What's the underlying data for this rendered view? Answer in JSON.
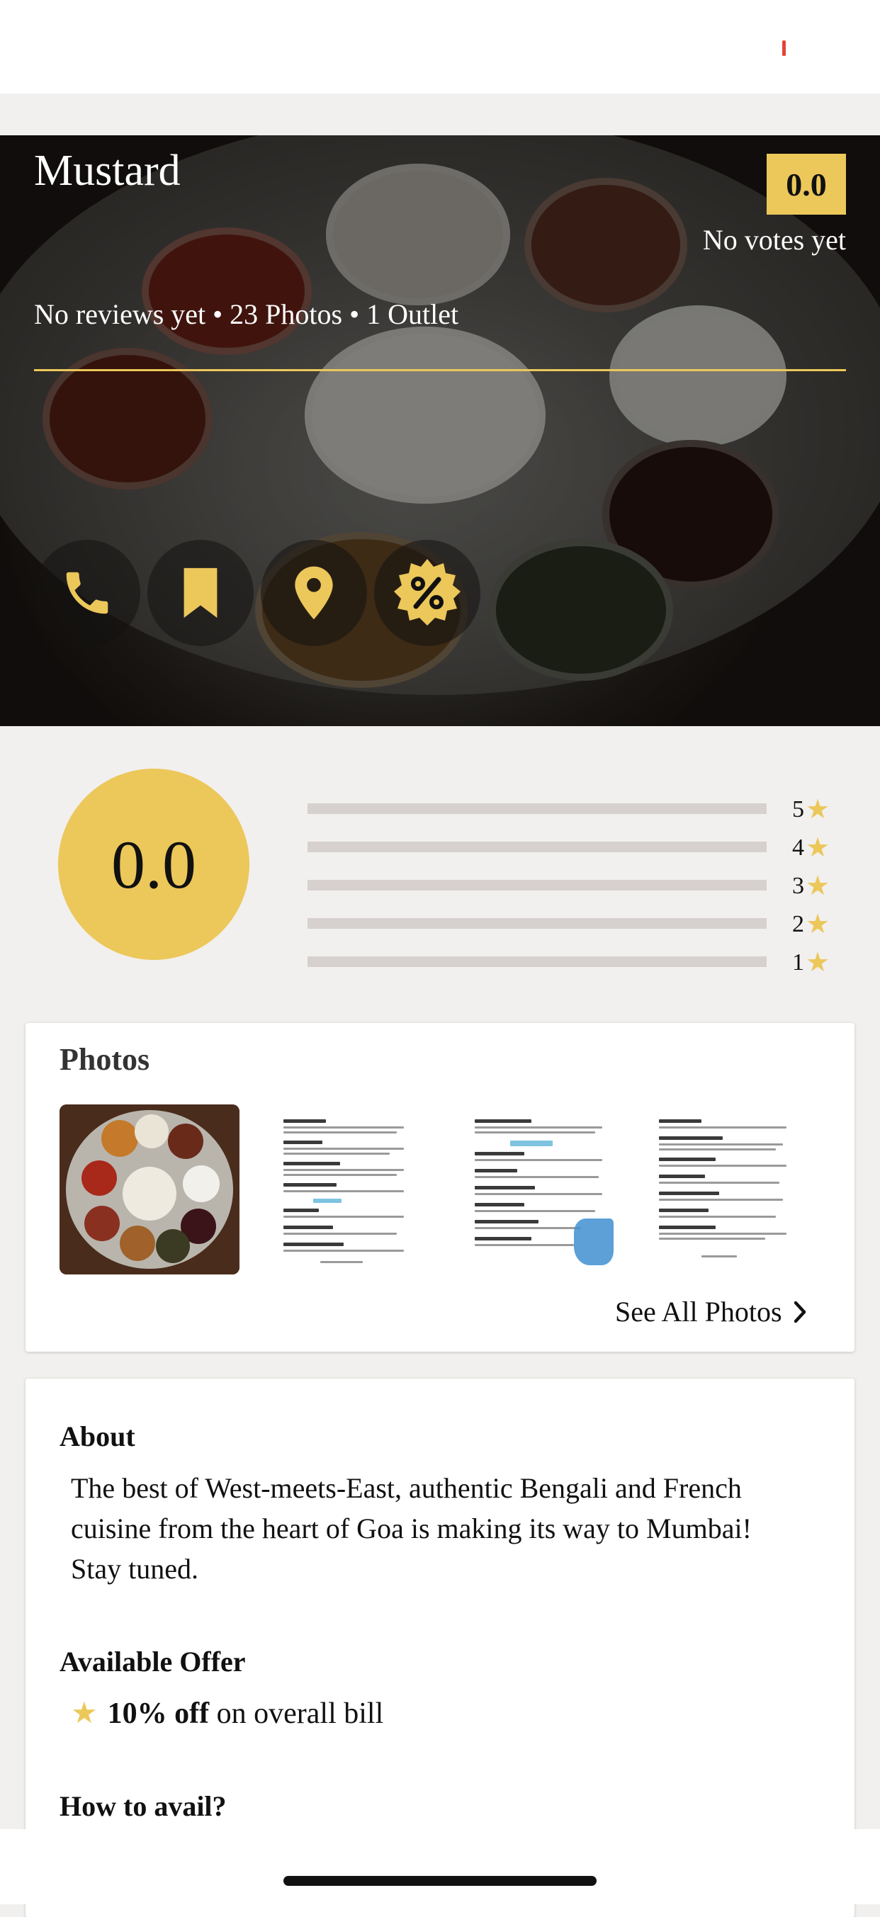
{
  "restaurant": {
    "name": "Mustard",
    "rating": "0.0",
    "votes_text": "No votes yet",
    "summary": "No reviews yet • 23 Photos • 1 Outlet"
  },
  "actions": [
    {
      "icon": "phone-icon"
    },
    {
      "icon": "bookmark-icon"
    },
    {
      "icon": "location-pin-icon"
    },
    {
      "icon": "discount-badge-icon"
    }
  ],
  "ratings": {
    "overall": "0.0",
    "distribution": [
      {
        "label": "5",
        "fraction": 0
      },
      {
        "label": "4",
        "fraction": 0
      },
      {
        "label": "3",
        "fraction": 0
      },
      {
        "label": "2",
        "fraction": 0
      },
      {
        "label": "1",
        "fraction": 0
      }
    ]
  },
  "photos": {
    "title": "Photos",
    "see_all": "See All Photos"
  },
  "about": {
    "title": "About",
    "text": "The best of West-meets-East, authentic Bengali and French cuisine from the heart of Goa is making its way to Mumbai! Stay tuned."
  },
  "offer": {
    "title": "Available Offer",
    "bold": "10% off",
    "rest": "on overall bill"
  },
  "how_to_avail": {
    "title": "How to avail?"
  },
  "colors": {
    "accent": "#ecc75a",
    "status_red": "#e5433a"
  }
}
